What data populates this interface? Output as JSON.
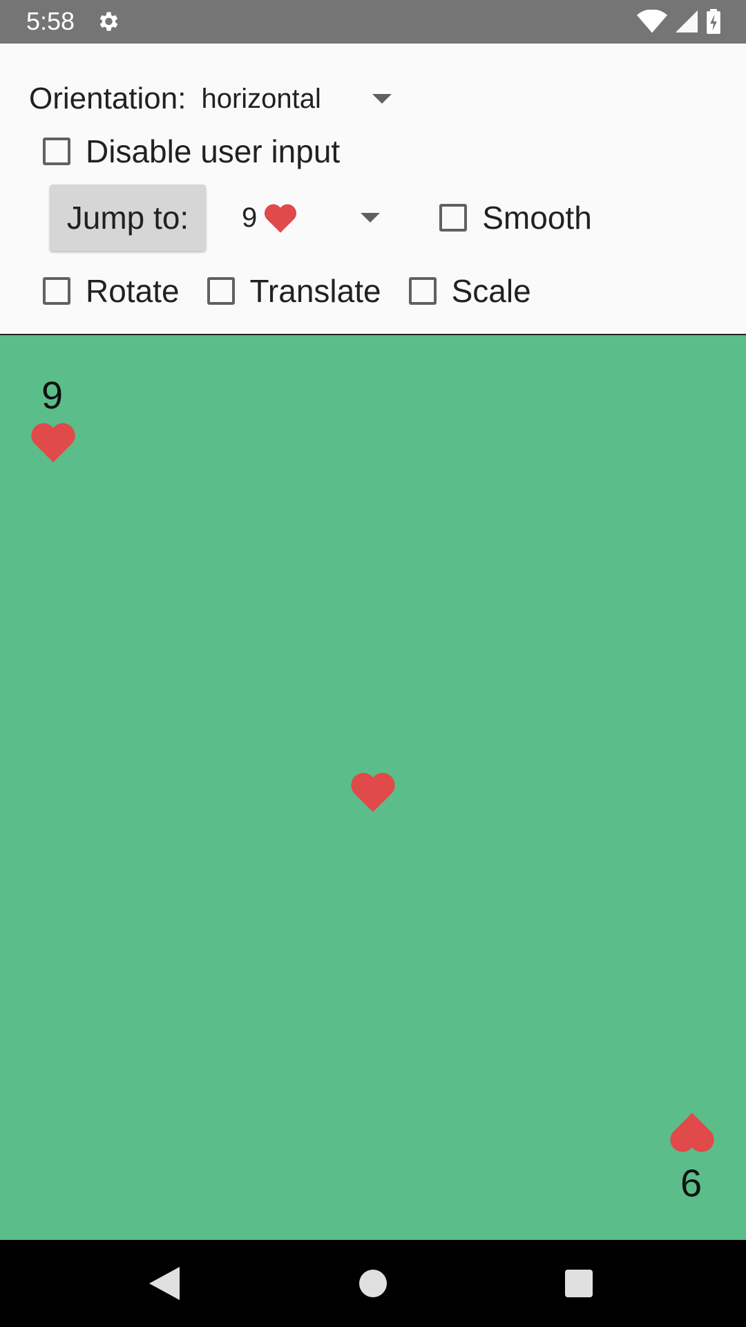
{
  "status_bar": {
    "time": "5:58",
    "icons": [
      "gear-icon",
      "wifi-icon",
      "signal-icon",
      "battery-charging-icon"
    ]
  },
  "controls": {
    "orientation_label": "Orientation:",
    "orientation_value": "horizontal",
    "disable_input_label": "Disable user input",
    "disable_input_checked": false,
    "jump_button_label": "Jump to:",
    "jump_select_value": "9",
    "jump_select_suit": "heart-icon",
    "smooth_label": "Smooth",
    "smooth_checked": false,
    "rotate_label": "Rotate",
    "rotate_checked": false,
    "translate_label": "Translate",
    "translate_checked": false,
    "scale_label": "Scale",
    "scale_checked": false
  },
  "card": {
    "rank_top": "9",
    "rank_bottom": "6",
    "suit": "heart-icon",
    "table_color": "#5bbd8a",
    "suit_color": "#e04a4a"
  },
  "nav_bar": {
    "buttons": [
      "back-icon",
      "home-icon",
      "recents-icon"
    ]
  }
}
